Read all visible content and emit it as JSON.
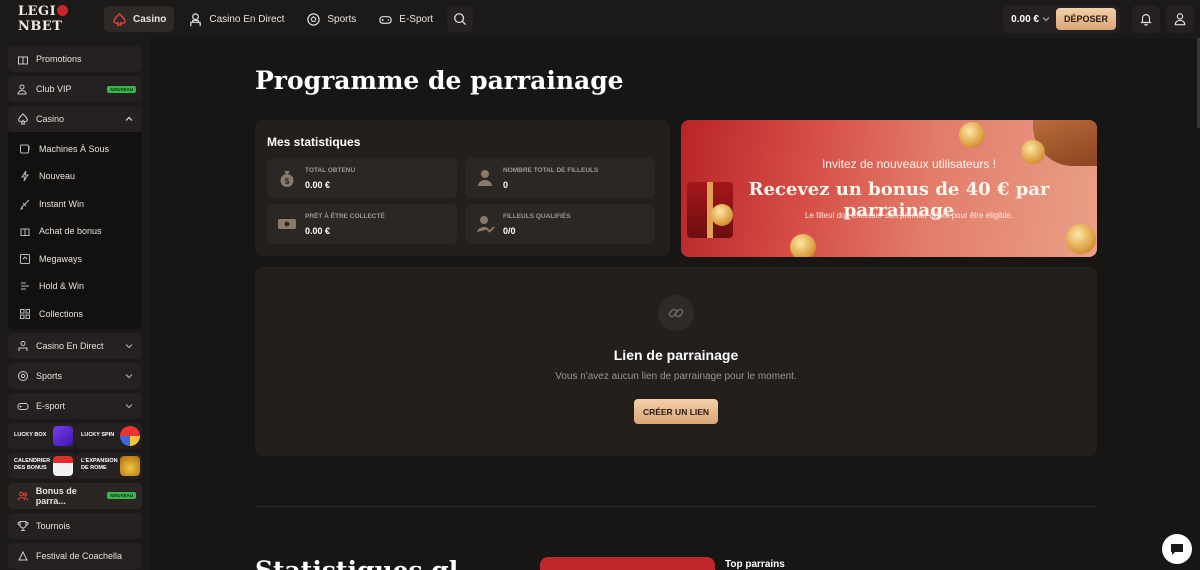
{
  "header": {
    "logo": {
      "part1": "LEGI",
      "part2": "NBET"
    },
    "nav": [
      {
        "label": "Casino",
        "icon": "spade-icon",
        "active": true
      },
      {
        "label": "Casino En Direct",
        "icon": "dealer-icon",
        "active": false
      },
      {
        "label": "Sports",
        "icon": "soccer-ball-icon",
        "active": false
      },
      {
        "label": "E-Sport",
        "icon": "gamepad-icon",
        "active": false
      }
    ],
    "balance": "0.00 €",
    "deposit_label": "DÉPOSER"
  },
  "sidebar": {
    "promotions": "Promotions",
    "club_vip": "Club VIP",
    "new_badge": "NOUVEAU",
    "casino": "Casino",
    "casino_sub": [
      "Machines À Sous",
      "Nouveau",
      "Instant Win",
      "Achat de bonus",
      "Megaways",
      "Hold & Win",
      "Collections"
    ],
    "casino_live": "Casino En Direct",
    "sports": "Sports",
    "esport": "E-sport",
    "promos": [
      {
        "l1": "LUCKY BOX",
        "l2": ""
      },
      {
        "l1": "LUCKY SPIN",
        "l2": ""
      },
      {
        "l1": "CALENDRIER",
        "l2": "DES BONUS"
      },
      {
        "l1": "L'EXPANSION",
        "l2": "DE ROME"
      }
    ],
    "referral": "Bonus de parra...",
    "tournaments": "Tournois",
    "festival": "Festival de Coachella"
  },
  "main": {
    "title": "Programme de parrainage",
    "stats": {
      "title": "Mes statistiques",
      "total_label": "TOTAL OBTENU",
      "total_value": "0.00 €",
      "filleuls_label": "NOMBRE TOTAL DE FILLEULS",
      "filleuls_value": "0",
      "ready_label": "PRÊT À ÊTRE COLLECTÉ",
      "ready_value": "0.00 €",
      "qualified_label": "FILLEULS QUALIFIÉS",
      "qualified_value": "0/0"
    },
    "banner": {
      "line1": "Invitez de nouveaux utilisateurs !",
      "line2": "Recevez un bonus de 40 € par parrainage",
      "line3": "Le filleul doit effectuer son premier dépôt pour être éligible."
    },
    "link": {
      "title": "Lien de parrainage",
      "subtitle": "Vous n'avez aucun lien de parrainage pour le moment.",
      "button": "CRÉER UN LIEN"
    },
    "bottom_title": "Statistiques gl",
    "top_sponsors": "Top parrains"
  },
  "colors": {
    "accent": "#d9a678",
    "brand_red": "#c8262b",
    "badge_green": "#3bb54a"
  }
}
